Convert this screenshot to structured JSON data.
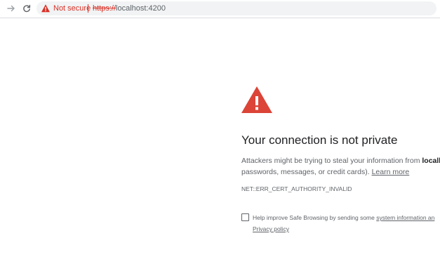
{
  "toolbar": {
    "security_label": "Not secure",
    "url_scheme": "https://",
    "url_host": "localhost:4200",
    "icons": {
      "forward": "forward-arrow-icon",
      "reload": "reload-icon",
      "security": "warning-triangle-icon"
    }
  },
  "interstitial": {
    "heading": "Your connection is not private",
    "body_prefix": "Attackers might be trying to steal your information from ",
    "body_host": "localho",
    "body_line2": "passwords, messages, or credit cards). ",
    "learn_more": "Learn more",
    "error_code": "NET::ERR_CERT_AUTHORITY_INVALID",
    "safe_browsing": {
      "checked": false,
      "text": "Help improve Safe Browsing by sending some ",
      "link": "system information an",
      "privacy_link": "Privacy policy"
    }
  },
  "colors": {
    "danger": "#d93025",
    "warning_icon": "#db4437",
    "text_primary": "#202124",
    "text_secondary": "#5f6368"
  }
}
